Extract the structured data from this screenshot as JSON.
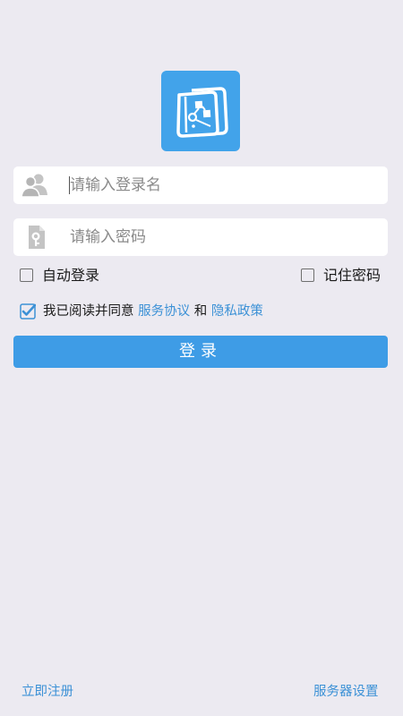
{
  "app": {
    "logo_icon": "flowchart-notebook-icon",
    "brand_color": "#42a3ea"
  },
  "login_form": {
    "username_placeholder": "请输入登录名",
    "username_icon": "users-icon",
    "password_placeholder": "请输入密码",
    "password_icon": "key-file-icon",
    "auto_login_label": "自动登录",
    "auto_login_checked": false,
    "remember_password_label": "记住密码",
    "remember_password_checked": false,
    "agree_prefix": "我已阅读并同意",
    "terms_link": "服务协议",
    "agree_and": "和",
    "privacy_link": "隐私政策",
    "agree_checked": true,
    "login_button": "登录"
  },
  "footer": {
    "register_link": "立即注册",
    "server_settings_link": "服务器设置"
  },
  "colors": {
    "background": "#eceaf1",
    "link": "#3c91d6",
    "button": "#3e9ce6"
  }
}
